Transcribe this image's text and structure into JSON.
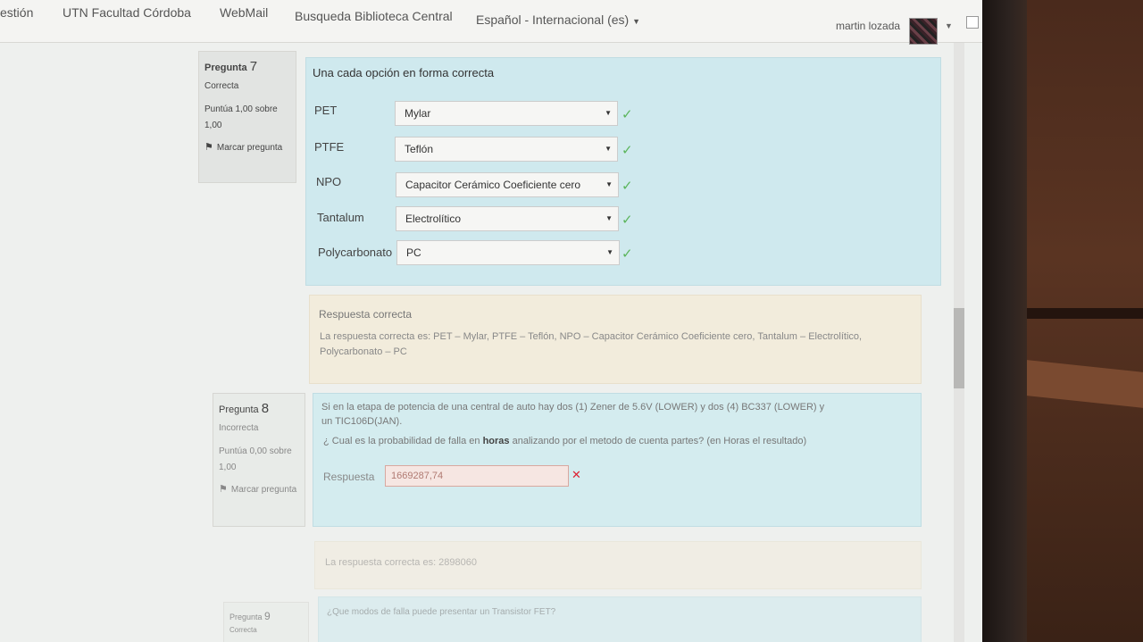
{
  "navbar": {
    "items": [
      "estión",
      "UTN Facultad Córdoba",
      "WebMail",
      "Busqueda Biblioteca Central",
      "Español - Internacional (es)"
    ],
    "user_name": "martin lozada"
  },
  "q7": {
    "label": "Pregunta",
    "number": "7",
    "state": "Correcta",
    "grade": "Puntúa 1,00 sobre 1,00",
    "flag": "Marcar pregunta",
    "prompt": "Una cada opción en forma correcta",
    "rows": [
      {
        "label": "PET",
        "value": "Mylar"
      },
      {
        "label": "PTFE",
        "value": "Teflón"
      },
      {
        "label": "NPO",
        "value": "Capacitor Cerámico Coeficiente cero"
      },
      {
        "label": "Tantalum",
        "value": "Electrolítico"
      },
      {
        "label": "Polycarbonato",
        "value": "PC"
      }
    ],
    "feedback_title": "Respuesta correcta",
    "feedback_text": "La respuesta correcta es: PET – Mylar, PTFE – Teflón, NPO – Capacitor Cerámico Coeficiente cero, Tantalum – Electrolítico, Polycarbonato – PC"
  },
  "q8": {
    "label": "Pregunta",
    "number": "8",
    "state": "Incorrecta",
    "grade": "Puntúa 0,00 sobre 1,00",
    "flag": "Marcar pregunta",
    "text_line1": "Si en la etapa de potencia de una central de auto hay dos (1) Zener de 5.6V (LOWER) y dos (4) BC337 (LOWER) y",
    "text_line2": "un TIC106D(JAN).",
    "text_q_pre": "¿ Cual es la probabilidad de falla en",
    "text_q_bold": "horas",
    "text_q_post": "analizando por el metodo de cuenta partes? (en Horas el resultado)",
    "answer_label": "Respuesta",
    "answer_value": "1669287,74",
    "feedback_text": "La respuesta correcta es: 2898060"
  },
  "q9": {
    "label": "Pregunta",
    "number": "9",
    "state": "Correcta",
    "prompt": "¿Que modos de falla puede presentar un Transistor FET?"
  },
  "colors": {
    "question_bg": "#cfe9ee",
    "feedback_bg": "#f2ecdc",
    "correct_check": "#5bb55b",
    "incorrect_cross": "#dd2233"
  }
}
